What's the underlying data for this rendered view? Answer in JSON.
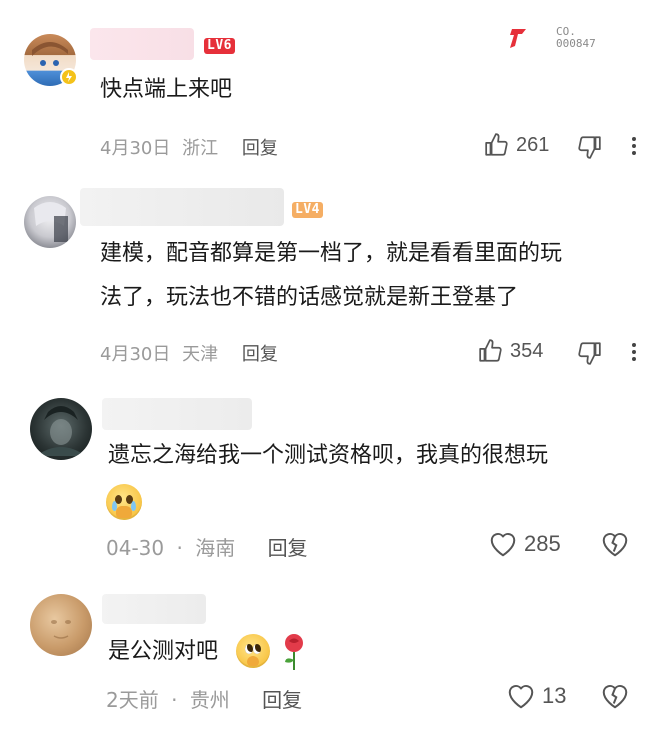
{
  "watermark": {
    "brand_glyph": "𝕵",
    "line1": "CO.",
    "line2": "000847",
    "accent": "#e6303a"
  },
  "comments": [
    {
      "level": "LV6",
      "level_color": "#e6303a",
      "text": "快点端上来吧",
      "date": "4月30日",
      "location": "浙江",
      "reply_label": "回复",
      "likes": "261"
    },
    {
      "level": "LV4",
      "level_color": "#f4a14a",
      "text_line1": "建模，配音都算是第一档了，就是看看里面的玩",
      "text_line2": "法了，玩法也不错的话感觉就是新王登基了",
      "date": "4月30日",
      "location": "天津",
      "reply_label": "回复",
      "likes": "354"
    },
    {
      "text": "遗忘之海给我一个测试资格呗，我真的很想玩",
      "date": "04-30",
      "location": "海南",
      "reply_label": "回复",
      "likes": "285"
    },
    {
      "text": "是公测对吧",
      "date": "2天前",
      "location": "贵州",
      "reply_label": "回复",
      "likes": "13"
    }
  ],
  "icons": {
    "thumb_up": "thumb-up-icon",
    "thumb_down": "thumb-down-icon",
    "heart": "heart-icon",
    "broken_heart": "broken-heart-icon",
    "more": "more-vertical-icon",
    "emoji_crying": "crying-emoji-icon",
    "emoji_pleading": "pleading-emoji-icon",
    "rose": "rose-icon"
  }
}
